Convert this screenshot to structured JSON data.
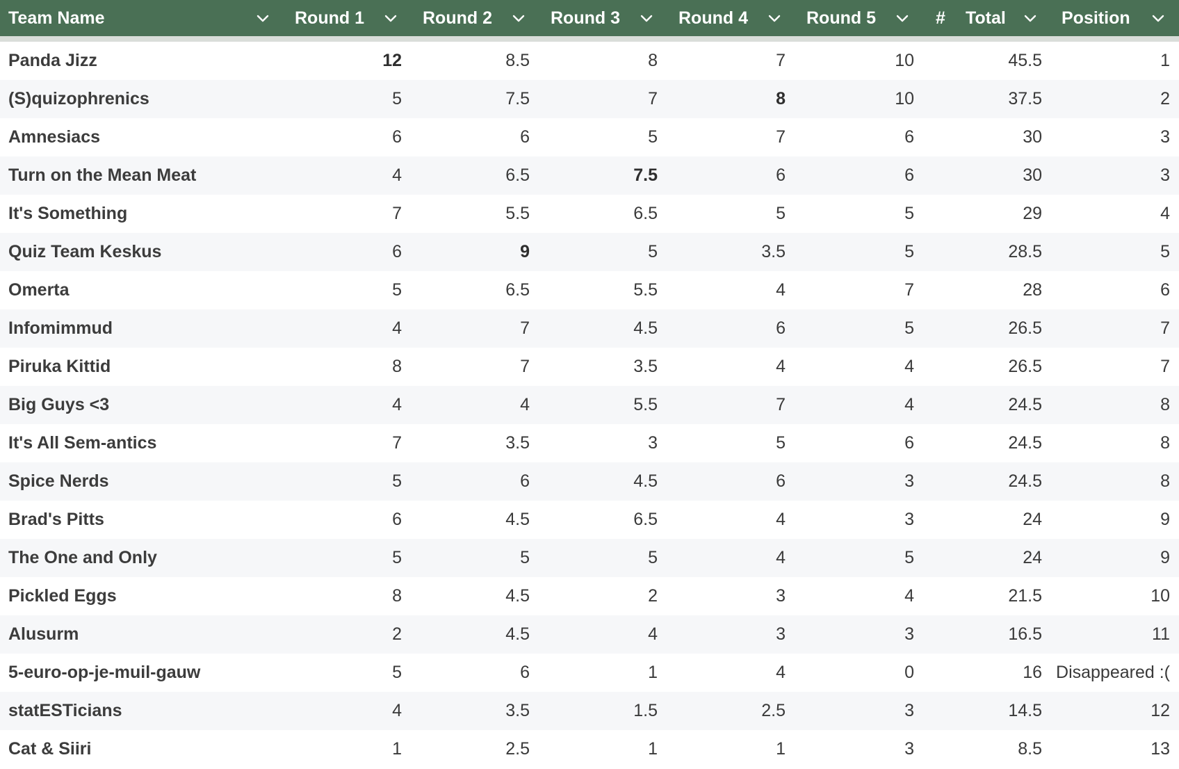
{
  "columns": [
    {
      "key": "team",
      "label": "Team Name"
    },
    {
      "key": "r1",
      "label": "Round 1"
    },
    {
      "key": "r2",
      "label": "Round 2"
    },
    {
      "key": "r3",
      "label": "Round 3"
    },
    {
      "key": "r4",
      "label": "Round 4"
    },
    {
      "key": "r5",
      "label": "Round 5"
    },
    {
      "key": "total",
      "label": "Total",
      "type_icon": "#"
    },
    {
      "key": "position",
      "label": "Position"
    }
  ],
  "rows": [
    {
      "team": "Panda Jizz",
      "r1": "12",
      "r2": "8.5",
      "r3": "8",
      "r4": "7",
      "r5": "10",
      "total": "45.5",
      "position": "1",
      "bold": [
        "r1"
      ]
    },
    {
      "team": "(S)quizophrenics",
      "r1": "5",
      "r2": "7.5",
      "r3": "7",
      "r4": "8",
      "r5": "10",
      "total": "37.5",
      "position": "2",
      "bold": [
        "r4"
      ]
    },
    {
      "team": "Amnesiacs",
      "r1": "6",
      "r2": "6",
      "r3": "5",
      "r4": "7",
      "r5": "6",
      "total": "30",
      "position": "3",
      "bold": []
    },
    {
      "team": "Turn on the Mean Meat",
      "r1": "4",
      "r2": "6.5",
      "r3": "7.5",
      "r4": "6",
      "r5": "6",
      "total": "30",
      "position": "3",
      "bold": [
        "r3"
      ]
    },
    {
      "team": "It's Something",
      "r1": "7",
      "r2": "5.5",
      "r3": "6.5",
      "r4": "5",
      "r5": "5",
      "total": "29",
      "position": "4",
      "bold": []
    },
    {
      "team": "Quiz Team Keskus",
      "r1": "6",
      "r2": "9",
      "r3": "5",
      "r4": "3.5",
      "r5": "5",
      "total": "28.5",
      "position": "5",
      "bold": [
        "r2"
      ]
    },
    {
      "team": "Omerta",
      "r1": "5",
      "r2": "6.5",
      "r3": "5.5",
      "r4": "4",
      "r5": "7",
      "total": "28",
      "position": "6",
      "bold": []
    },
    {
      "team": "Infomimmud",
      "r1": "4",
      "r2": "7",
      "r3": "4.5",
      "r4": "6",
      "r5": "5",
      "total": "26.5",
      "position": "7",
      "bold": []
    },
    {
      "team": "Piruka Kittid",
      "r1": "8",
      "r2": "7",
      "r3": "3.5",
      "r4": "4",
      "r5": "4",
      "total": "26.5",
      "position": "7",
      "bold": []
    },
    {
      "team": "Big Guys <3",
      "r1": "4",
      "r2": "4",
      "r3": "5.5",
      "r4": "7",
      "r5": "4",
      "total": "24.5",
      "position": "8",
      "bold": []
    },
    {
      "team": "It's All Sem-antics",
      "r1": "7",
      "r2": "3.5",
      "r3": "3",
      "r4": "5",
      "r5": "6",
      "total": "24.5",
      "position": "8",
      "bold": []
    },
    {
      "team": "Spice Nerds",
      "r1": "5",
      "r2": "6",
      "r3": "4.5",
      "r4": "6",
      "r5": "3",
      "total": "24.5",
      "position": "8",
      "bold": []
    },
    {
      "team": "Brad's Pitts",
      "r1": "6",
      "r2": "4.5",
      "r3": "6.5",
      "r4": "4",
      "r5": "3",
      "total": "24",
      "position": "9",
      "bold": []
    },
    {
      "team": "The One and Only",
      "r1": "5",
      "r2": "5",
      "r3": "5",
      "r4": "4",
      "r5": "5",
      "total": "24",
      "position": "9",
      "bold": []
    },
    {
      "team": "Pickled Eggs",
      "r1": "8",
      "r2": "4.5",
      "r3": "2",
      "r4": "3",
      "r5": "4",
      "total": "21.5",
      "position": "10",
      "bold": []
    },
    {
      "team": "Alusurm",
      "r1": "2",
      "r2": "4.5",
      "r3": "4",
      "r4": "3",
      "r5": "3",
      "total": "16.5",
      "position": "11",
      "bold": []
    },
    {
      "team": "5-euro-op-je-muil-gauw",
      "r1": "5",
      "r2": "6",
      "r3": "1",
      "r4": "4",
      "r5": "0",
      "total": "16",
      "position": "Disappeared :(",
      "bold": []
    },
    {
      "team": "statESTicians",
      "r1": "4",
      "r2": "3.5",
      "r3": "1.5",
      "r4": "2.5",
      "r5": "3",
      "total": "14.5",
      "position": "12",
      "bold": []
    },
    {
      "team": "Cat & Siiri",
      "r1": "1",
      "r2": "2.5",
      "r3": "1",
      "r4": "1",
      "r5": "3",
      "total": "8.5",
      "position": "13",
      "bold": []
    }
  ],
  "colors": {
    "header_bg": "#4a7055",
    "header_text": "#ffffff",
    "row_alt_bg": "#f6f7f9",
    "text": "#3a3a3a"
  },
  "icons": {
    "sort": "chevron-down-icon",
    "number_type": "hash-icon"
  }
}
